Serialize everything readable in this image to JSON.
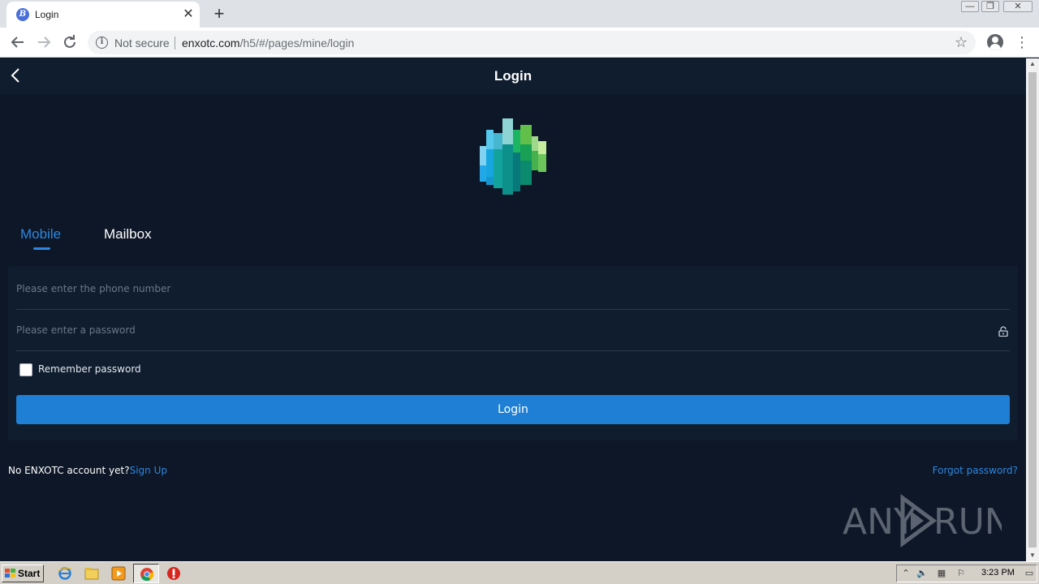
{
  "browser": {
    "tab_title": "Login",
    "tab_favicon_letter": "B",
    "tab_close": "✕",
    "new_tab": "+",
    "security_label": "Not secure",
    "url_host": "enxotc.com",
    "url_path": "/h5/#/pages/mine/login",
    "window_controls": {
      "minimize": "—",
      "restore": "❐",
      "close": "✕"
    }
  },
  "page": {
    "title": "Login",
    "tabs": [
      {
        "label": "Mobile",
        "active": true
      },
      {
        "label": "Mailbox",
        "active": false
      }
    ],
    "form": {
      "phone_placeholder": "Please enter the phone number",
      "password_placeholder": "Please enter a password",
      "remember_label": "Remember password",
      "login_button": "Login"
    },
    "footer": {
      "no_account_text": "No ENXOTC account yet?",
      "signup_link": "Sign Up",
      "forgot_link": "Forgot password?"
    },
    "watermark": {
      "left": "ANY",
      "right": "RUN"
    }
  },
  "colors": {
    "page_background": "#0d1727",
    "header_background": "#0f1d2e",
    "accent": "#2d86e0",
    "button": "#1f7fd4"
  },
  "taskbar": {
    "start_label": "Start",
    "clock": "3:23 PM"
  }
}
